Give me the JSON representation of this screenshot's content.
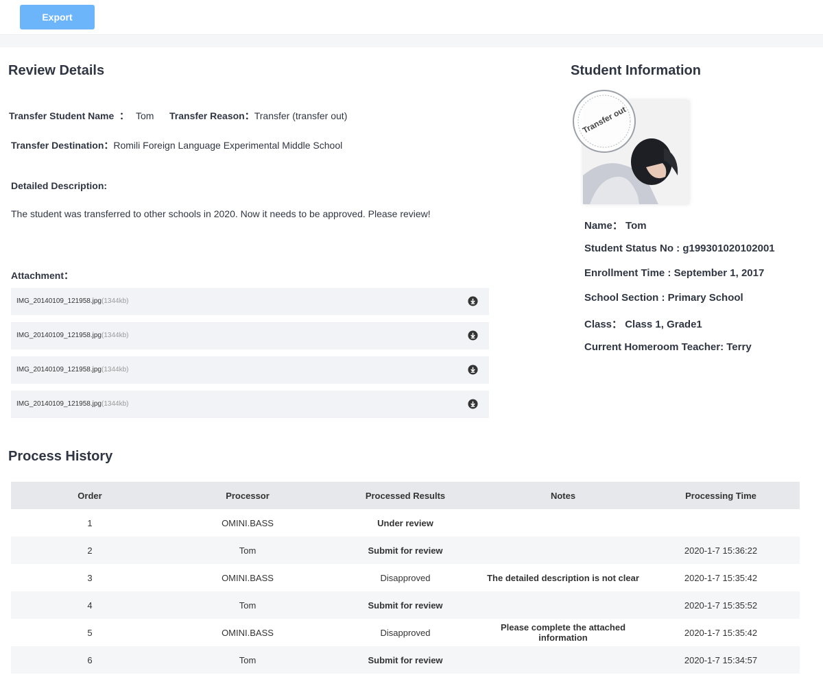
{
  "toolbar": {
    "export_label": "Export"
  },
  "review": {
    "title": "Review Details",
    "student_name_label": "Transfer Student Name  ：",
    "student_name": "Tom",
    "reason_label": "Transfer Reason：",
    "reason": "Transfer (transfer out)",
    "destination_label": "Transfer Destination：",
    "destination": "Romili Foreign Language Experimental Middle School",
    "description_label": "Detailed Description:",
    "description": "The student was transferred to other schools in 2020. Now it needs to be approved. Please review!",
    "attachment_label": "Attachment：",
    "attachments": [
      {
        "name": "IMG_20140109_121958.jpg",
        "size": "(1344kb)",
        "icon": "download-icon"
      },
      {
        "name": "IMG_20140109_121958.jpg",
        "size": "(1344kb)",
        "icon": "download-icon"
      },
      {
        "name": "IMG_20140109_121958.jpg",
        "size": "(1344kb)",
        "icon": "download-icon"
      },
      {
        "name": "IMG_20140109_121958.jpg",
        "size": "(1344kb)",
        "icon": "download-icon"
      }
    ]
  },
  "student": {
    "title": "Student Information",
    "stamp_text": "Transfer out",
    "name": "Name： Tom",
    "status_no": "Student Status No : g199301020102001",
    "enrollment": "Enrollment Time : September 1, 2017",
    "section": "School Section : Primary School",
    "class": "Class： Class 1, Grade1",
    "teacher": "Current Homeroom Teacher: Terry"
  },
  "history": {
    "title": "Process History",
    "columns": [
      "Order",
      "Processor",
      "Processed Results",
      "Notes",
      "Processing Time"
    ],
    "rows": [
      {
        "order": "1",
        "processor": "OMINI.BASS",
        "result": "Under review",
        "notes": "",
        "time": ""
      },
      {
        "order": "2",
        "processor": "Tom",
        "result": "Submit for review",
        "notes": "",
        "time": "2020-1-7 15:36:22"
      },
      {
        "order": "3",
        "processor": "OMINI.BASS",
        "result": "Disapproved",
        "notes": "The detailed description is not clear",
        "time": "2020-1-7 15:35:42"
      },
      {
        "order": "4",
        "processor": "Tom",
        "result": "Submit for review",
        "notes": "",
        "time": "2020-1-7 15:35:52"
      },
      {
        "order": "5",
        "processor": "OMINI.BASS",
        "result": "Disapproved",
        "notes": "Please complete the attached information",
        "time": "2020-1-7 15:35:42"
      },
      {
        "order": "6",
        "processor": "Tom",
        "result": "Submit for review",
        "notes": "",
        "time": "2020-1-7 15:34:57"
      }
    ]
  },
  "colors": {
    "accent": "#6cb5fb",
    "table_header": "#e6e8ec",
    "stripe": "#f5f6f8",
    "attachment_bg": "#f2f3f7"
  }
}
